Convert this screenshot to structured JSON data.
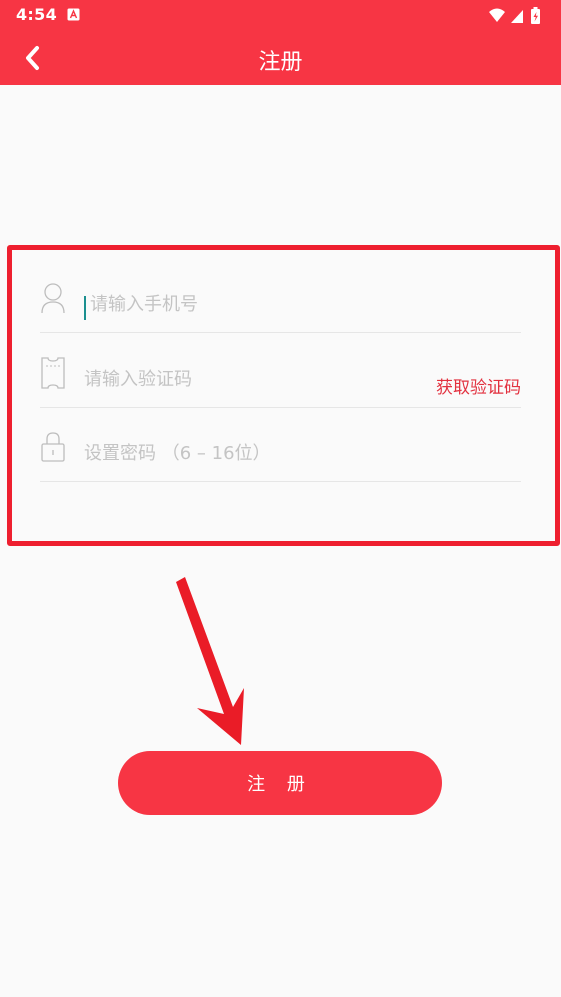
{
  "status_bar": {
    "time": "4:54",
    "notification_icon": "a-notification-icon",
    "icons": [
      "wifi-icon",
      "signal-icon",
      "battery-charging-icon"
    ]
  },
  "app_bar": {
    "back_icon": "chevron-left-icon",
    "title": "注册"
  },
  "form": {
    "phone": {
      "icon": "user-icon",
      "placeholder": "请输入手机号",
      "value": ""
    },
    "code": {
      "icon": "ticket-icon",
      "placeholder": "请输入验证码",
      "value": "",
      "get_code_label": "获取验证码"
    },
    "password": {
      "icon": "lock-icon",
      "placeholder": "设置密码 （6 – 16位）",
      "value": ""
    }
  },
  "submit_label": "注 册",
  "colors": {
    "primary": "#f73544",
    "highlight_border": "#ee1f2f",
    "link": "#e2313f",
    "placeholder": "#c4c4c4"
  }
}
